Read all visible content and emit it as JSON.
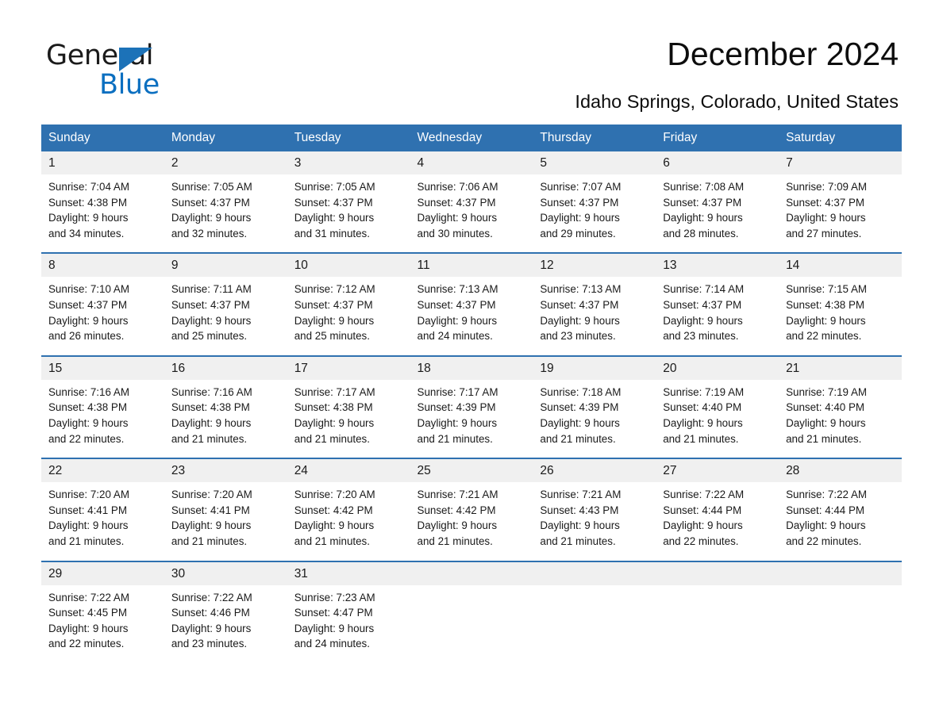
{
  "brand": {
    "name_part1": "General",
    "name_part2": "Blue",
    "logo_icon": "triangle-logo-icon",
    "accent_color": "#1c72b8"
  },
  "header": {
    "title": "December 2024",
    "subtitle": "Idaho Springs, Colorado, United States"
  },
  "colors": {
    "header_blue": "#2f71b0",
    "daynum_band": "#f0f0f0",
    "text": "#1a1a1a"
  },
  "weekdays": [
    "Sunday",
    "Monday",
    "Tuesday",
    "Wednesday",
    "Thursday",
    "Friday",
    "Saturday"
  ],
  "weeks": [
    {
      "days": [
        {
          "num": "1",
          "sunrise": "Sunrise: 7:04 AM",
          "sunset": "Sunset: 4:38 PM",
          "daylight1": "Daylight: 9 hours",
          "daylight2": "and 34 minutes."
        },
        {
          "num": "2",
          "sunrise": "Sunrise: 7:05 AM",
          "sunset": "Sunset: 4:37 PM",
          "daylight1": "Daylight: 9 hours",
          "daylight2": "and 32 minutes."
        },
        {
          "num": "3",
          "sunrise": "Sunrise: 7:05 AM",
          "sunset": "Sunset: 4:37 PM",
          "daylight1": "Daylight: 9 hours",
          "daylight2": "and 31 minutes."
        },
        {
          "num": "4",
          "sunrise": "Sunrise: 7:06 AM",
          "sunset": "Sunset: 4:37 PM",
          "daylight1": "Daylight: 9 hours",
          "daylight2": "and 30 minutes."
        },
        {
          "num": "5",
          "sunrise": "Sunrise: 7:07 AM",
          "sunset": "Sunset: 4:37 PM",
          "daylight1": "Daylight: 9 hours",
          "daylight2": "and 29 minutes."
        },
        {
          "num": "6",
          "sunrise": "Sunrise: 7:08 AM",
          "sunset": "Sunset: 4:37 PM",
          "daylight1": "Daylight: 9 hours",
          "daylight2": "and 28 minutes."
        },
        {
          "num": "7",
          "sunrise": "Sunrise: 7:09 AM",
          "sunset": "Sunset: 4:37 PM",
          "daylight1": "Daylight: 9 hours",
          "daylight2": "and 27 minutes."
        }
      ]
    },
    {
      "days": [
        {
          "num": "8",
          "sunrise": "Sunrise: 7:10 AM",
          "sunset": "Sunset: 4:37 PM",
          "daylight1": "Daylight: 9 hours",
          "daylight2": "and 26 minutes."
        },
        {
          "num": "9",
          "sunrise": "Sunrise: 7:11 AM",
          "sunset": "Sunset: 4:37 PM",
          "daylight1": "Daylight: 9 hours",
          "daylight2": "and 25 minutes."
        },
        {
          "num": "10",
          "sunrise": "Sunrise: 7:12 AM",
          "sunset": "Sunset: 4:37 PM",
          "daylight1": "Daylight: 9 hours",
          "daylight2": "and 25 minutes."
        },
        {
          "num": "11",
          "sunrise": "Sunrise: 7:13 AM",
          "sunset": "Sunset: 4:37 PM",
          "daylight1": "Daylight: 9 hours",
          "daylight2": "and 24 minutes."
        },
        {
          "num": "12",
          "sunrise": "Sunrise: 7:13 AM",
          "sunset": "Sunset: 4:37 PM",
          "daylight1": "Daylight: 9 hours",
          "daylight2": "and 23 minutes."
        },
        {
          "num": "13",
          "sunrise": "Sunrise: 7:14 AM",
          "sunset": "Sunset: 4:37 PM",
          "daylight1": "Daylight: 9 hours",
          "daylight2": "and 23 minutes."
        },
        {
          "num": "14",
          "sunrise": "Sunrise: 7:15 AM",
          "sunset": "Sunset: 4:38 PM",
          "daylight1": "Daylight: 9 hours",
          "daylight2": "and 22 minutes."
        }
      ]
    },
    {
      "days": [
        {
          "num": "15",
          "sunrise": "Sunrise: 7:16 AM",
          "sunset": "Sunset: 4:38 PM",
          "daylight1": "Daylight: 9 hours",
          "daylight2": "and 22 minutes."
        },
        {
          "num": "16",
          "sunrise": "Sunrise: 7:16 AM",
          "sunset": "Sunset: 4:38 PM",
          "daylight1": "Daylight: 9 hours",
          "daylight2": "and 21 minutes."
        },
        {
          "num": "17",
          "sunrise": "Sunrise: 7:17 AM",
          "sunset": "Sunset: 4:38 PM",
          "daylight1": "Daylight: 9 hours",
          "daylight2": "and 21 minutes."
        },
        {
          "num": "18",
          "sunrise": "Sunrise: 7:17 AM",
          "sunset": "Sunset: 4:39 PM",
          "daylight1": "Daylight: 9 hours",
          "daylight2": "and 21 minutes."
        },
        {
          "num": "19",
          "sunrise": "Sunrise: 7:18 AM",
          "sunset": "Sunset: 4:39 PM",
          "daylight1": "Daylight: 9 hours",
          "daylight2": "and 21 minutes."
        },
        {
          "num": "20",
          "sunrise": "Sunrise: 7:19 AM",
          "sunset": "Sunset: 4:40 PM",
          "daylight1": "Daylight: 9 hours",
          "daylight2": "and 21 minutes."
        },
        {
          "num": "21",
          "sunrise": "Sunrise: 7:19 AM",
          "sunset": "Sunset: 4:40 PM",
          "daylight1": "Daylight: 9 hours",
          "daylight2": "and 21 minutes."
        }
      ]
    },
    {
      "days": [
        {
          "num": "22",
          "sunrise": "Sunrise: 7:20 AM",
          "sunset": "Sunset: 4:41 PM",
          "daylight1": "Daylight: 9 hours",
          "daylight2": "and 21 minutes."
        },
        {
          "num": "23",
          "sunrise": "Sunrise: 7:20 AM",
          "sunset": "Sunset: 4:41 PM",
          "daylight1": "Daylight: 9 hours",
          "daylight2": "and 21 minutes."
        },
        {
          "num": "24",
          "sunrise": "Sunrise: 7:20 AM",
          "sunset": "Sunset: 4:42 PM",
          "daylight1": "Daylight: 9 hours",
          "daylight2": "and 21 minutes."
        },
        {
          "num": "25",
          "sunrise": "Sunrise: 7:21 AM",
          "sunset": "Sunset: 4:42 PM",
          "daylight1": "Daylight: 9 hours",
          "daylight2": "and 21 minutes."
        },
        {
          "num": "26",
          "sunrise": "Sunrise: 7:21 AM",
          "sunset": "Sunset: 4:43 PM",
          "daylight1": "Daylight: 9 hours",
          "daylight2": "and 21 minutes."
        },
        {
          "num": "27",
          "sunrise": "Sunrise: 7:22 AM",
          "sunset": "Sunset: 4:44 PM",
          "daylight1": "Daylight: 9 hours",
          "daylight2": "and 22 minutes."
        },
        {
          "num": "28",
          "sunrise": "Sunrise: 7:22 AM",
          "sunset": "Sunset: 4:44 PM",
          "daylight1": "Daylight: 9 hours",
          "daylight2": "and 22 minutes."
        }
      ]
    },
    {
      "days": [
        {
          "num": "29",
          "sunrise": "Sunrise: 7:22 AM",
          "sunset": "Sunset: 4:45 PM",
          "daylight1": "Daylight: 9 hours",
          "daylight2": "and 22 minutes."
        },
        {
          "num": "30",
          "sunrise": "Sunrise: 7:22 AM",
          "sunset": "Sunset: 4:46 PM",
          "daylight1": "Daylight: 9 hours",
          "daylight2": "and 23 minutes."
        },
        {
          "num": "31",
          "sunrise": "Sunrise: 7:23 AM",
          "sunset": "Sunset: 4:47 PM",
          "daylight1": "Daylight: 9 hours",
          "daylight2": "and 24 minutes."
        },
        {
          "num": "",
          "sunrise": "",
          "sunset": "",
          "daylight1": "",
          "daylight2": ""
        },
        {
          "num": "",
          "sunrise": "",
          "sunset": "",
          "daylight1": "",
          "daylight2": ""
        },
        {
          "num": "",
          "sunrise": "",
          "sunset": "",
          "daylight1": "",
          "daylight2": ""
        },
        {
          "num": "",
          "sunrise": "",
          "sunset": "",
          "daylight1": "",
          "daylight2": ""
        }
      ]
    }
  ]
}
